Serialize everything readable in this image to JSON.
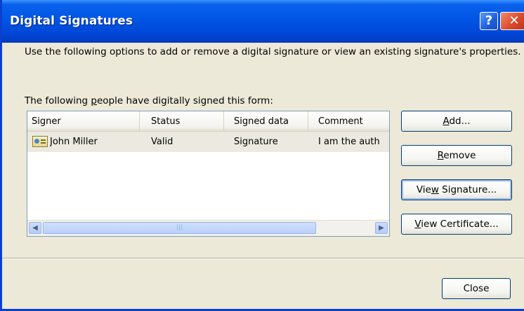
{
  "window": {
    "title": "Digital Signatures"
  },
  "titlebar": {
    "help_glyph": "?",
    "close_glyph": "✕"
  },
  "description": "Use the following options to add or remove a digital signature or view an existing signature's properties.",
  "list_caption": {
    "before": "The following ",
    "accel": "p",
    "after": "eople have digitally signed this form:"
  },
  "list": {
    "columns": [
      "Signer",
      "Status",
      "Signed data",
      "Comment"
    ],
    "rows": [
      {
        "icon": "certificate-icon",
        "signer": "John Miller",
        "status": "Valid",
        "signed_data": "Signature",
        "comment": "I am the auth"
      }
    ]
  },
  "scrollbar": {
    "left": "◀",
    "right": "▶",
    "grip": "|||"
  },
  "buttons": {
    "add": {
      "accel": "A",
      "rest": "dd..."
    },
    "remove": {
      "accel": "R",
      "rest": "emove"
    },
    "view_signature": {
      "before": "Vie",
      "accel": "w",
      "after": " Signature..."
    },
    "view_certificate": {
      "accel": "V",
      "rest": "iew Certificate..."
    },
    "close": "Close"
  }
}
